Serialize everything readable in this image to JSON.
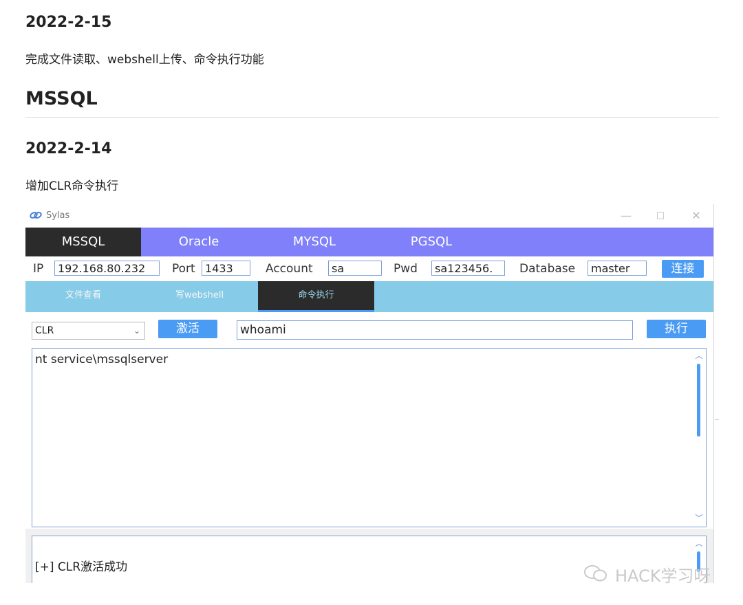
{
  "doc": {
    "date1": "2022-2-15",
    "note1": "完成文件读取、webshell上传、命令执行功能",
    "section": "MSSQL",
    "date2": "2022-2-14",
    "note2": "增加CLR命令执行"
  },
  "window": {
    "title": "Sylas",
    "controls": {
      "minimize": "—",
      "maximize": "□",
      "close": "✕"
    }
  },
  "db_tabs": [
    "MSSQL",
    "Oracle",
    "MYSQL",
    "PGSQL"
  ],
  "db_tab_active": "MSSQL",
  "connection": {
    "ip_label": "IP",
    "ip_value": "192.168.80.232",
    "port_label": "Port",
    "port_value": "1433",
    "account_label": "Account",
    "account_value": "sa",
    "pwd_label": "Pwd",
    "pwd_value": "sa123456.",
    "database_label": "Database",
    "database_value": "master",
    "connect_button": "连接"
  },
  "sub_tabs": [
    "文件查看",
    "写webshell",
    "命令执行"
  ],
  "sub_tab_active": "命令执行",
  "command": {
    "method_selected": "CLR",
    "activate_button": "激活",
    "input_value": "whoami",
    "execute_button": "执行"
  },
  "output": {
    "text": "nt service\\mssqlserver"
  },
  "log": {
    "text": "[+] CLR激活成功"
  },
  "watermark": "HACK学习呀",
  "colors": {
    "db_tab_bar": "#8080fb",
    "sub_tab_bar": "#86cbe8",
    "active_tab": "#2b2b2b",
    "button_blue": "#4a9bf4",
    "input_border": "#7a9fd6"
  }
}
